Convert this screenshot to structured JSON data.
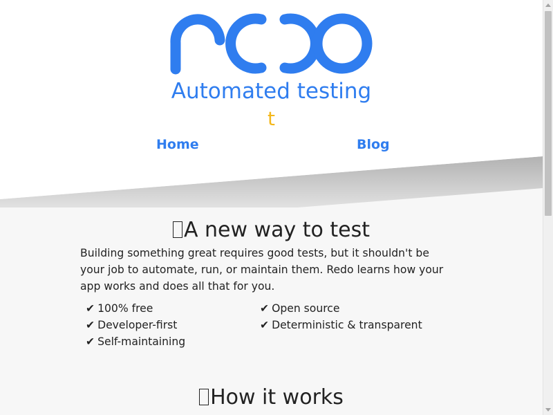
{
  "header": {
    "logo_text": "redo",
    "tagline": "Automated testing",
    "typed_text": "t",
    "nav": [
      {
        "label": "Home"
      },
      {
        "label": "Blog"
      }
    ]
  },
  "sections": [
    {
      "title": "A new way to test",
      "body": "Building something great requires good tests, but it shouldn't be your job to automate, run, or maintain them. Redo learns how your app works and does all that for you.",
      "features": [
        {
          "check": "✔",
          "label": "100% free"
        },
        {
          "check": "✔",
          "label": "Open source"
        },
        {
          "check": "✔",
          "label": "Developer-first"
        },
        {
          "check": "✔",
          "label": "Deterministic & transparent"
        },
        {
          "check": "✔",
          "label": "Self-maintaining"
        }
      ]
    },
    {
      "title": "How it works"
    }
  ],
  "colors": {
    "brand_blue": "#2f7def",
    "typed_yellow": "#f4b71b",
    "text": "#222222",
    "background": "#f7f7f7"
  },
  "icons": {
    "feature_check": "check-mark-icon",
    "title_glyph": "missing-glyph-icon"
  }
}
